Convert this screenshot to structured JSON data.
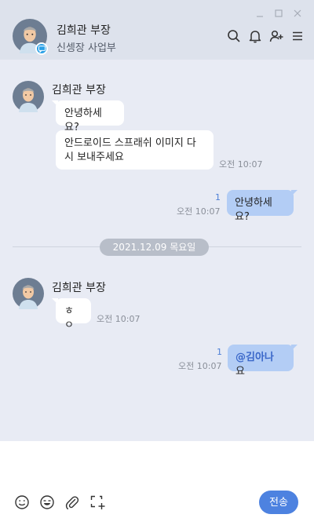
{
  "header": {
    "name": "김희관 부장",
    "department": "신셍장 사업부",
    "window_controls": [
      "minimize-icon",
      "maximize-icon",
      "close-icon"
    ],
    "actions": [
      "search-icon",
      "bell-icon",
      "add-user-icon",
      "menu-icon"
    ]
  },
  "messages": [
    {
      "sender": "김희관 부장",
      "bubbles": [
        "안녕하세요?",
        "안드로이드 스프래쉬 이미지 다시 보내주세요"
      ],
      "time": "오전 10:07"
    },
    {
      "mine": true,
      "unread": "1",
      "time": "오전 10:07",
      "text": "안녕하세요?"
    }
  ],
  "date_divider": "2021.12.09 목요일",
  "messages2": [
    {
      "sender": "김희관 부장",
      "bubble": "ㅎㅇ",
      "time": "오전 10:07"
    },
    {
      "mine": true,
      "unread": "1",
      "time": "오전 10:07",
      "mention": "@김아나",
      "text": "요"
    }
  ],
  "composer": {
    "tools": [
      "emoji-icon",
      "emoticon-icon",
      "attachment-icon",
      "capture-icon"
    ],
    "send_label": "전송"
  },
  "colors": {
    "header_bg": "#dde2ec",
    "chat_bg": "#e8ebf4",
    "my_bubble": "#b3cdf5",
    "send_button": "#4d82e0",
    "badge": "#2aa0e6"
  }
}
